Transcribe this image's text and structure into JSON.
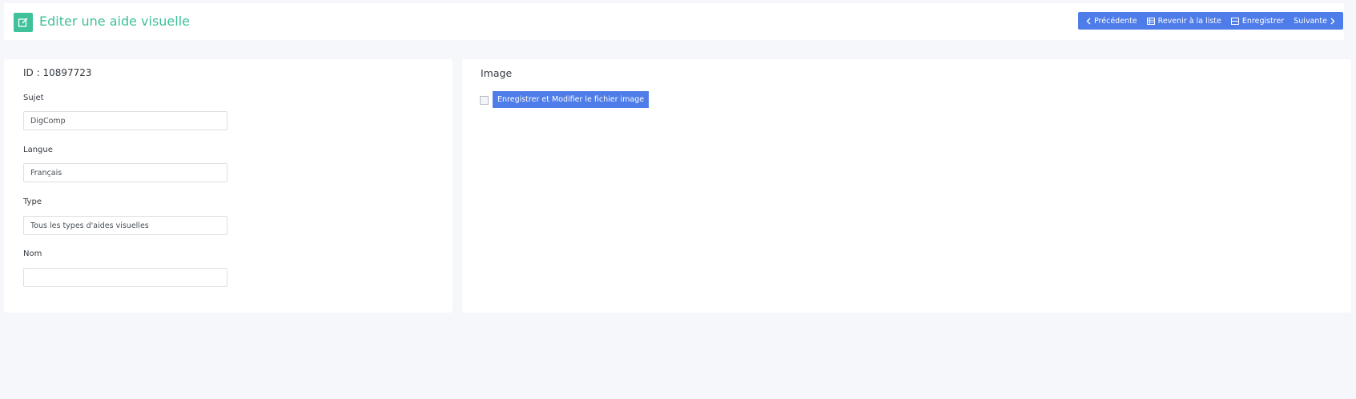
{
  "header": {
    "title": "Editer une aide visuelle",
    "title_icon": "edit-icon",
    "accent_color": "#3fc19a",
    "buttons": {
      "prev_label": "Précédente",
      "back_label": "Revenir à la liste",
      "save_label": "Enregistrer",
      "next_label": "Suivante"
    },
    "button_color": "#4e7ce8"
  },
  "form": {
    "id_label": "ID : 10897723",
    "fields": [
      {
        "label": "Sujet",
        "value": "DigComp"
      },
      {
        "label": "Langue",
        "value": "Français"
      },
      {
        "label": "Type",
        "value": "Tous les types d'aides visuelles"
      },
      {
        "label": "Nom",
        "value": ""
      }
    ]
  },
  "image_panel": {
    "title": "Image",
    "upload_label": "Enregistrer et Modifier le fichier image"
  }
}
